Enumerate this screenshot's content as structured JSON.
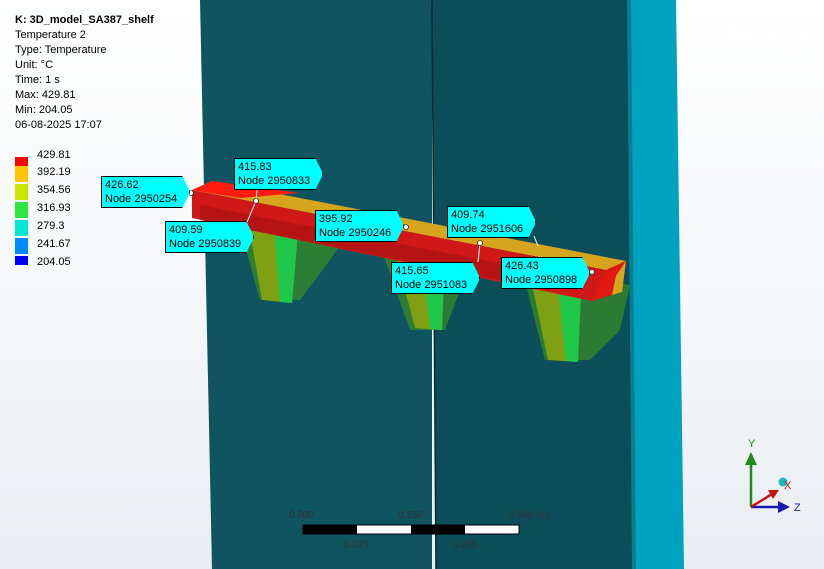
{
  "info": {
    "title": "K: 3D_model_SA387_shelf",
    "result_name": "Temperature 2",
    "type": "Type: Temperature",
    "unit": "Unit: °C",
    "time": "Time: 1 s",
    "max": "Max: 429.81",
    "min": "Min: 204.05",
    "timestamp": "06-08-2025 17:07"
  },
  "legend": [
    {
      "label": "429.81",
      "color": "#ff0000"
    },
    {
      "label": "392.19",
      "color": "#ffc600"
    },
    {
      "label": "354.56",
      "color": "#c8e600"
    },
    {
      "label": "316.93",
      "color": "#2ee640"
    },
    {
      "label": "279.3",
      "color": "#00e6d2"
    },
    {
      "label": "241.67",
      "color": "#008cff"
    },
    {
      "label": "204.05",
      "color": "#0000ff"
    }
  ],
  "brand": {
    "name": "Ansys",
    "version": "2024 R1"
  },
  "probes": [
    {
      "value": "426.62",
      "node": "Node 2950254"
    },
    {
      "value": "415.83",
      "node": "Node 2950833"
    },
    {
      "value": "409.59",
      "node": "Node 2950839"
    },
    {
      "value": "395.92",
      "node": "Node 2950246"
    },
    {
      "value": "409.74",
      "node": "Node 2951606"
    },
    {
      "value": "415.65",
      "node": "Node 2951083"
    },
    {
      "value": "426.43",
      "node": "Node 2950898"
    }
  ],
  "scale_bar": {
    "top_labels": [
      "0.000",
      "0.150",
      "0.300 (m)"
    ],
    "bottom_labels": [
      "0.075",
      "0.225"
    ]
  },
  "triad": {
    "x": "X",
    "y": "Y",
    "z": "Z"
  }
}
